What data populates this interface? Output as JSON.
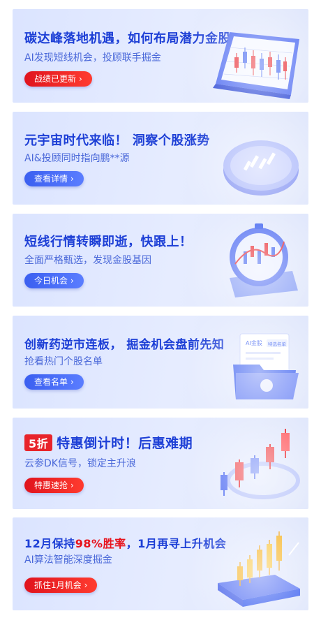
{
  "banners": [
    {
      "title": "碳达峰落地机遇，如何布局潜力金股",
      "subtitle": "AI发现短线机会，投顾联手掘金",
      "button": "战绩已更新",
      "button_style": "red",
      "illustration": "candlestick-screen-icon"
    },
    {
      "title": "元宇宙时代来临！ 洞察个股涨势",
      "subtitle": "AI&投顾同时指向鹏**源",
      "button": "查看详情",
      "button_style": "blue",
      "illustration": "candlestick-coin-icon"
    },
    {
      "title": "短线行情转瞬即逝，快跟上！",
      "subtitle": "全面严格甄选，发现金股基因",
      "button": "今日机会",
      "button_style": "blue",
      "illustration": "stopwatch-chart-icon"
    },
    {
      "title": "创新药逆市连板， 掘金机会盘前先知",
      "subtitle": "抢看热门个股名单",
      "button": "查看名单",
      "button_style": "blue",
      "illustration": "folder-documents-icon",
      "doc_label": "AI金股",
      "doc_tag": "特选名单"
    },
    {
      "title_tag": "5折",
      "title": "特惠倒计时！后惠难期",
      "subtitle": "云参DK信号，锁定主升浪",
      "button": "特惠速抢",
      "button_style": "red",
      "illustration": "rising-bars-icon"
    },
    {
      "title_prefix": "12月保持",
      "title_highlight": "98%胜率",
      "title_suffix": "，1月再寻上升机会",
      "subtitle": "AI算法智能深度掘金",
      "button": "抓住1月机会",
      "button_style": "red",
      "illustration": "gold-bars-platform-icon"
    }
  ],
  "chevron": "›",
  "colors": {
    "title_blue": "#1d3fd6",
    "sub_blue": "#4a68d9",
    "btn_blue": "#3b5ff0",
    "btn_red": "#e0141e",
    "card_bg": "#e3eaff"
  }
}
